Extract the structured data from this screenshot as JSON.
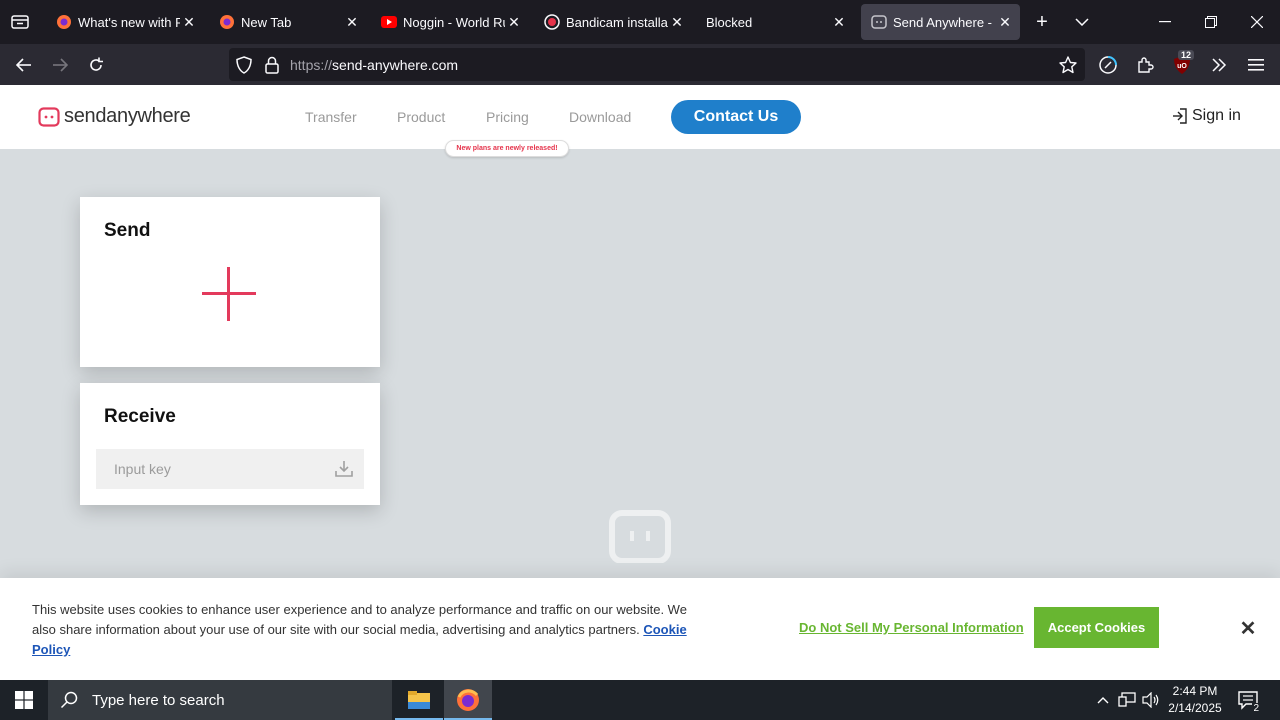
{
  "browser": {
    "tabs": [
      {
        "title": "What's new with Fire",
        "favicon": "firefox-icon",
        "active": false
      },
      {
        "title": "New Tab",
        "favicon": "firefox-icon",
        "active": false
      },
      {
        "title": "Noggin - World Runn",
        "favicon": "youtube-icon",
        "active": false
      },
      {
        "title": "Bandicam installatio",
        "favicon": "record-icon",
        "active": false
      },
      {
        "title": "Blocked",
        "favicon": "",
        "active": false
      },
      {
        "title": "Send Anywhere - Fil",
        "favicon": "sendanywhere-icon",
        "active": true
      }
    ],
    "url_scheme": "https://",
    "url_host": "send-anywhere.com",
    "extension_badge": "12"
  },
  "site": {
    "logo_bold": "send",
    "logo_rest": "anywhere",
    "nav": [
      "Transfer",
      "Product",
      "Pricing",
      "Download"
    ],
    "contact_label": "Contact Us",
    "pricing_tooltip": "New plans are newly released!",
    "signin_label": "Sign in",
    "brand_color": "#e33a5c",
    "contact_color": "#1f7fcb"
  },
  "send_card": {
    "title": "Send"
  },
  "receive_card": {
    "title": "Receive",
    "input_placeholder": "Input key"
  },
  "cookie_banner": {
    "text": "This website uses cookies to enhance user experience and to analyze performance and traffic on our website. We also share information about your use of our site with our social media, advertising and analytics partners.",
    "policy_link": "Cookie Policy",
    "dns_link": "Do Not Sell My Personal Information",
    "accept_label": "Accept Cookies",
    "accent_color": "#68b631"
  },
  "taskbar": {
    "search_placeholder": "Type here to search",
    "time": "2:44 PM",
    "date": "2/14/2025",
    "notification_count": "2"
  }
}
